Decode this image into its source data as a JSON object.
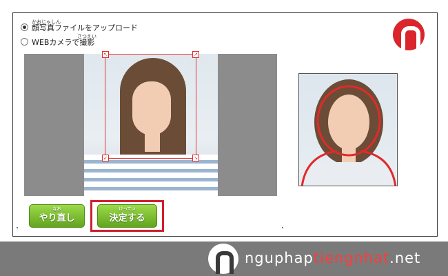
{
  "upload_options": [
    {
      "label": "顔写真ファイルをアップロード",
      "ruby": "かおじゃしん",
      "selected": true
    },
    {
      "label": "WEBカメラで撮影",
      "ruby": "さつえい",
      "selected": false
    }
  ],
  "buttons": {
    "redo": {
      "label": "やり直し",
      "ruby": "なお"
    },
    "confirm": {
      "label": "決定する",
      "ruby": "けってい"
    }
  },
  "watermark": {
    "prefix": "nguphap",
    "highlight": "tiengnhat",
    "suffix": ".net"
  },
  "colors": {
    "accent_red": "#d01f2a",
    "button_green": "#7cc236",
    "footer_gray": "#7a7a7a"
  }
}
